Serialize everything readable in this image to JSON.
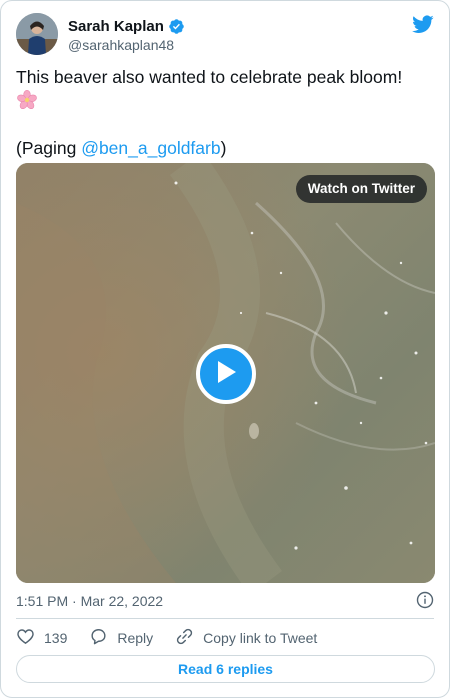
{
  "author": {
    "display_name": "Sarah Kaplan",
    "handle": "@sarahkaplan48",
    "verified": true,
    "avatar_icon": "profile-photo"
  },
  "tweet": {
    "line1": "This beaver also wanted to celebrate peak bloom!",
    "emoji_icon": "cherry-blossom-icon",
    "paging_prefix": "(Paging ",
    "mention": "@ben_a_goldfarb",
    "paging_suffix": ")"
  },
  "media": {
    "watch_label": "Watch on Twitter",
    "play_icon": "play-icon"
  },
  "meta": {
    "timestamp": "1:51 PM · Mar 22, 2022",
    "info_icon": "info-icon"
  },
  "actions": {
    "like_count": "139",
    "reply_label": "Reply",
    "copy_link_label": "Copy link to Tweet"
  },
  "footer": {
    "read_replies_label": "Read 6 replies"
  },
  "colors": {
    "accent": "#1d9bf0",
    "text": "#0f1419",
    "secondary": "#536471",
    "border": "#cfd9de"
  }
}
